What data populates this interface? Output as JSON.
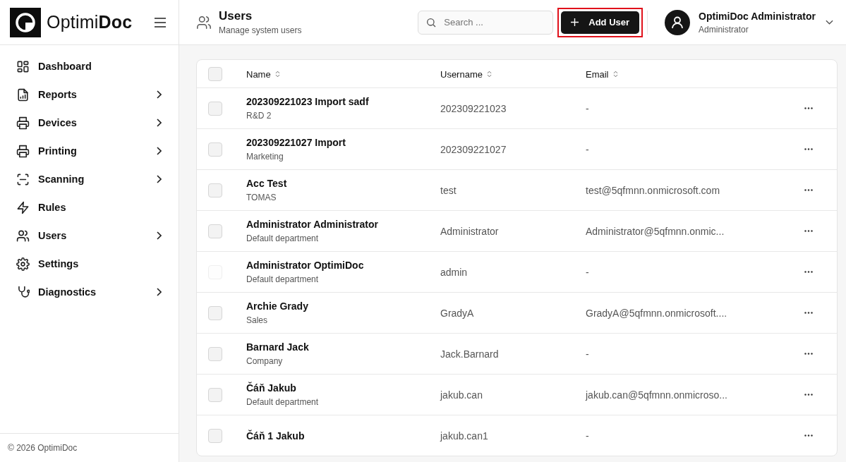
{
  "brand": {
    "light": "Optimi",
    "bold": "Doc"
  },
  "sidebar": {
    "items": [
      {
        "label": "Dashboard",
        "expandable": false
      },
      {
        "label": "Reports",
        "expandable": true
      },
      {
        "label": "Devices",
        "expandable": true
      },
      {
        "label": "Printing",
        "expandable": true
      },
      {
        "label": "Scanning",
        "expandable": true
      },
      {
        "label": "Rules",
        "expandable": false
      },
      {
        "label": "Users",
        "expandable": true
      },
      {
        "label": "Settings",
        "expandable": false
      },
      {
        "label": "Diagnostics",
        "expandable": true
      }
    ],
    "footer": "© 2026 OptimiDoc"
  },
  "header": {
    "title": "Users",
    "subtitle": "Manage system users",
    "search": {
      "placeholder": "Search ..."
    },
    "add_button": {
      "label": "Add User",
      "highlighted": true
    },
    "user": {
      "name": "OptimiDoc Administrator",
      "role": "Administrator"
    }
  },
  "table": {
    "select_all": {
      "checked": false
    },
    "columns": [
      "Name",
      "Username",
      "Email"
    ],
    "rows": [
      {
        "name": "202309221023 Import sadf",
        "department": "R&D 2",
        "username": "202309221023",
        "email": "-",
        "checked": false,
        "disabled": false
      },
      {
        "name": "202309221027 Import",
        "department": "Marketing",
        "username": "202309221027",
        "email": "-",
        "checked": false,
        "disabled": false
      },
      {
        "name": "Acc Test",
        "department": "TOMAS",
        "username": "test",
        "email": "test@5qfmnn.onmicrosoft.com",
        "checked": false,
        "disabled": false
      },
      {
        "name": "Administrator Administrator",
        "department": "Default department",
        "username": "Administrator",
        "email": "Administrator@5qfmnn.onmic...",
        "checked": false,
        "disabled": false
      },
      {
        "name": "Administrator OptimiDoc",
        "department": "Default department",
        "username": "admin",
        "email": "-",
        "checked": false,
        "disabled": true
      },
      {
        "name": "Archie Grady",
        "department": "Sales",
        "username": "GradyA",
        "email": "GradyA@5qfmnn.onmicrosoft....",
        "checked": false,
        "disabled": false
      },
      {
        "name": "Barnard Jack",
        "department": "Company",
        "username": "Jack.Barnard",
        "email": "-",
        "checked": false,
        "disabled": false
      },
      {
        "name": "Čáň Jakub",
        "department": "Default department",
        "username": "jakub.can",
        "email": "jakub.can@5qfmnn.onmicroso...",
        "checked": false,
        "disabled": false
      },
      {
        "name": "Čáň 1 Jakub",
        "username": "jakub.can1",
        "email": "-",
        "checked": false,
        "disabled": false
      }
    ]
  }
}
